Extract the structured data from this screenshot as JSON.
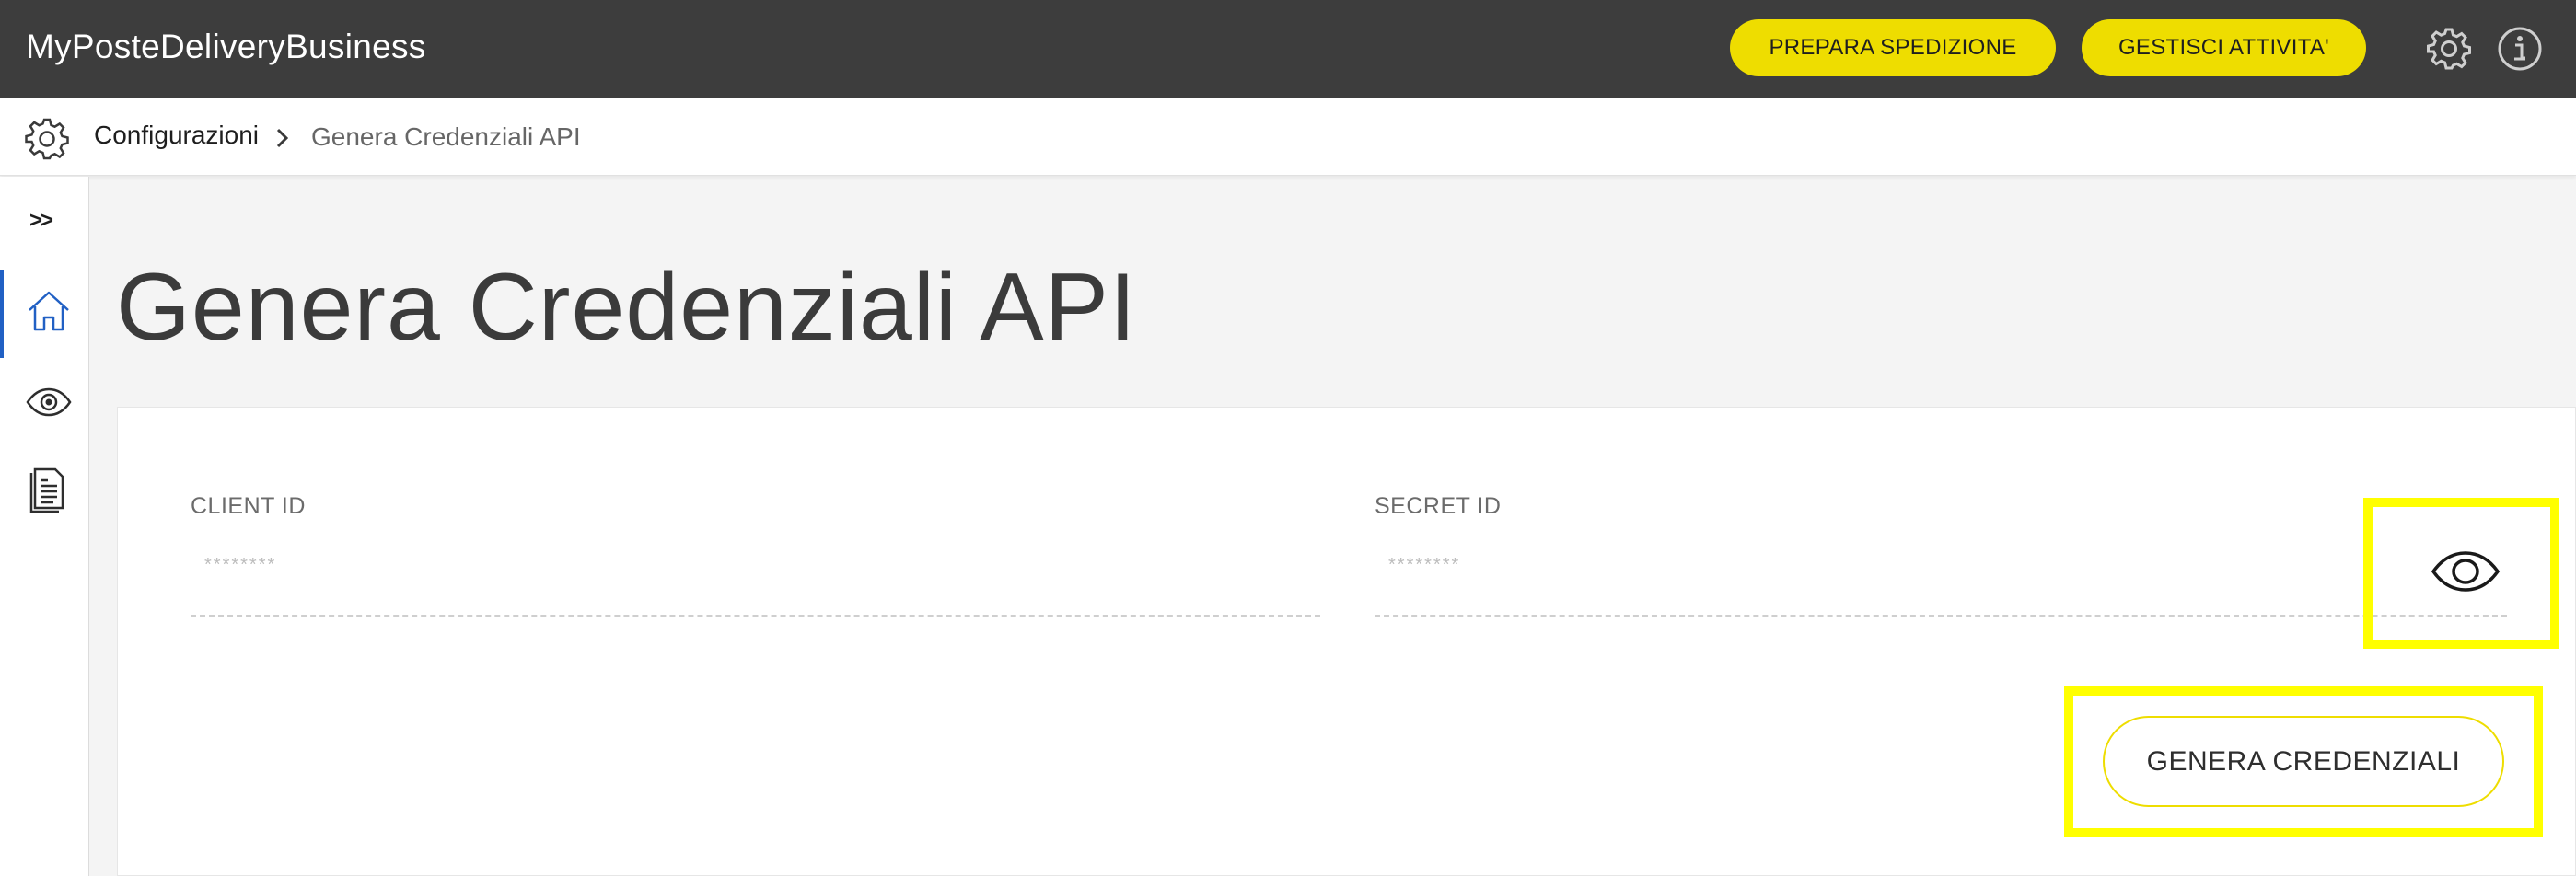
{
  "app": {
    "title": "MyPosteDeliveryBusiness"
  },
  "header": {
    "prepara_label": "PREPARA SPEDIZIONE",
    "gestisci_label": "GESTISCI ATTIVITA'"
  },
  "breadcrumb": {
    "parent": "Configurazioni",
    "current": "Genera Credenziali API"
  },
  "sidebar": {
    "expand_label": ">>",
    "items": [
      {
        "icon": "home-icon",
        "active": true
      },
      {
        "icon": "eye-icon",
        "active": false
      },
      {
        "icon": "document-icon",
        "active": false
      }
    ]
  },
  "main": {
    "title": "Genera Credenziali API",
    "client_id": {
      "label": "CLIENT ID",
      "value": "********"
    },
    "secret_id": {
      "label": "SECRET ID",
      "value": "********"
    },
    "generate_label": "GENERA CREDENZIALI"
  },
  "colors": {
    "topbar": "#3d3d3d",
    "accent": "#eedd00",
    "active_nav": "#2160c4",
    "highlight": "#ffff00"
  }
}
